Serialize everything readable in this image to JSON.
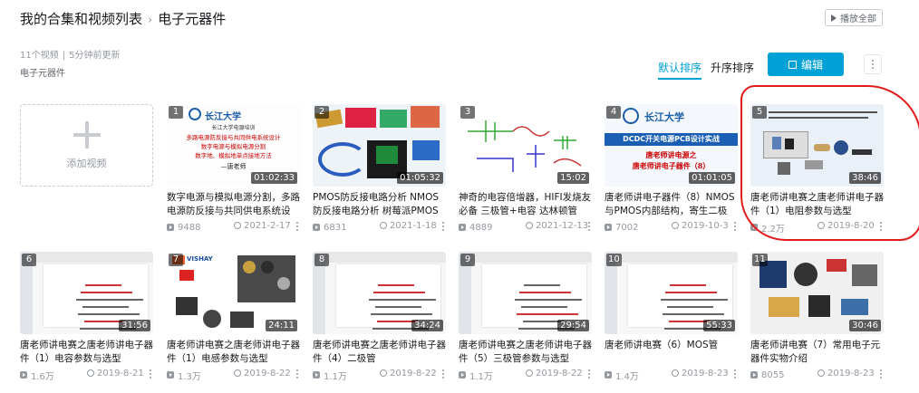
{
  "header": {
    "breadcrumb_root": "我的合集和视频列表",
    "breadcrumb_sep": "›",
    "collection_name": "电子元器件",
    "play_all_label": "播放全部"
  },
  "meta": {
    "video_count": "11个视频",
    "updated": "5分钟前更新",
    "description": "电子元器件"
  },
  "toolbar": {
    "sort_default": "默认排序",
    "sort_asc": "升序排序",
    "edit_label": "编辑"
  },
  "add_card": {
    "label": "添加视频"
  },
  "videos": [
    {
      "index": "1",
      "duration": "01:02:33",
      "title": "数字电源与模拟电源分割，多路电源防反接与共同供电系统设计，数",
      "views": "9488",
      "date": "2021-2-17"
    },
    {
      "index": "2",
      "duration": "01:05:32",
      "title": "PMOS防反接电路分析 NMOS防反接电路分析 树莓派PMOS理想二极",
      "views": "6831",
      "date": "2021-1-18"
    },
    {
      "index": "3",
      "duration": "15:02",
      "title": "神奇的电容倍增器，HIFI发烧友必备 三极管+电容 达林顿管+电容",
      "views": "4889",
      "date": "2021-12-13"
    },
    {
      "index": "4",
      "duration": "01:01:05",
      "title": "唐老师讲电子器件（8）NMOS与PMOS内部结构，寄生二极管，体",
      "views": "7002",
      "date": "2019-10-3"
    },
    {
      "index": "5",
      "duration": "38:46",
      "title": "唐老师讲电赛之唐老师讲电子器件（1）电阻参数与选型",
      "views": "2.2万",
      "date": "2019-8-20"
    },
    {
      "index": "6",
      "duration": "31:56",
      "title": "唐老师讲电赛之唐老师讲电子器件（1）电容参数与选型",
      "views": "1.6万",
      "date": "2019-8-21"
    },
    {
      "index": "7",
      "duration": "24:11",
      "title": "唐老师讲电赛之唐老师讲电子器件（1）电感参数与选型",
      "views": "1.3万",
      "date": "2019-8-22"
    },
    {
      "index": "8",
      "duration": "34:24",
      "title": "唐老师讲电赛之唐老师讲电子器件（4）二极管",
      "views": "1.1万",
      "date": "2019-8-22"
    },
    {
      "index": "9",
      "duration": "29:54",
      "title": "唐老师讲电赛之唐老师讲电子器件（5）三极管参数与选型",
      "views": "1.1万",
      "date": "2019-8-22"
    },
    {
      "index": "10",
      "duration": "55:33",
      "title": "唐老师讲电赛（6）MOS管",
      "views": "1.4万",
      "date": "2019-8-23"
    },
    {
      "index": "11",
      "duration": "30:46",
      "title": "唐老师讲电赛（7）常用电子元器件实物介绍",
      "views": "8055",
      "date": "2019-8-23"
    }
  ],
  "thumb_text": {
    "t1_logo": "长江大学",
    "t1_lines": [
      "长江大学电源培训",
      "多路电源防反接与共同供电系统设计",
      "数字电源与模拟电源分割",
      "数字地、模拟地单点接地方法",
      "—唐老师"
    ],
    "t4_banner": "DCDC开关电源PCB设计实战",
    "t4_lines": [
      "唐老师讲电源之",
      "唐老师讲电子器件（8）"
    ],
    "t6_lines": [
      "常用电子元器件参数与选型",
      "唐老师讲电子器件"
    ],
    "t7_brand": "VISHAY"
  },
  "colors": {
    "accent": "#00a1d6",
    "highlight_ring": "#e21b1b"
  }
}
